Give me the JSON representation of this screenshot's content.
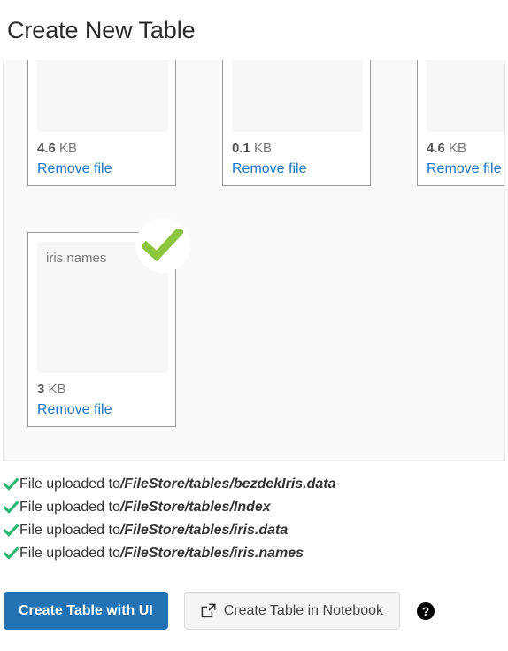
{
  "page": {
    "title": "Create New Table"
  },
  "uploader": {
    "files": [
      {
        "name": "",
        "size_value": "4.6",
        "size_unit": "KB",
        "remove_label": "Remove file",
        "uploaded": false,
        "row": 1
      },
      {
        "name": "",
        "size_value": "0.1",
        "size_unit": "KB",
        "remove_label": "Remove file",
        "uploaded": false,
        "row": 1
      },
      {
        "name": "",
        "size_value": "4.6",
        "size_unit": "KB",
        "remove_label": "Remove file",
        "uploaded": false,
        "row": 1
      },
      {
        "name": "iris.names",
        "size_value": "3",
        "size_unit": "KB",
        "remove_label": "Remove file",
        "uploaded": true,
        "row": 2
      }
    ]
  },
  "status_messages": [
    {
      "text": "File uploaded to ",
      "path": "/FileStore/tables/bezdekIris.data"
    },
    {
      "text": "File uploaded to ",
      "path": "/FileStore/tables/Index"
    },
    {
      "text": "File uploaded to ",
      "path": "/FileStore/tables/iris.data"
    },
    {
      "text": "File uploaded to ",
      "path": "/FileStore/tables/iris.names"
    }
  ],
  "actions": {
    "primary_label": "Create Table with UI",
    "secondary_label": "Create Table in Notebook",
    "help_label": "?"
  },
  "colors": {
    "primary_button": "#2272b4",
    "link": "#1b76c3",
    "status_check": "#2cb673",
    "card_check": "#8cc63e",
    "dropzone_bg": "#fafafa",
    "card_border": "#9b9b9b"
  }
}
